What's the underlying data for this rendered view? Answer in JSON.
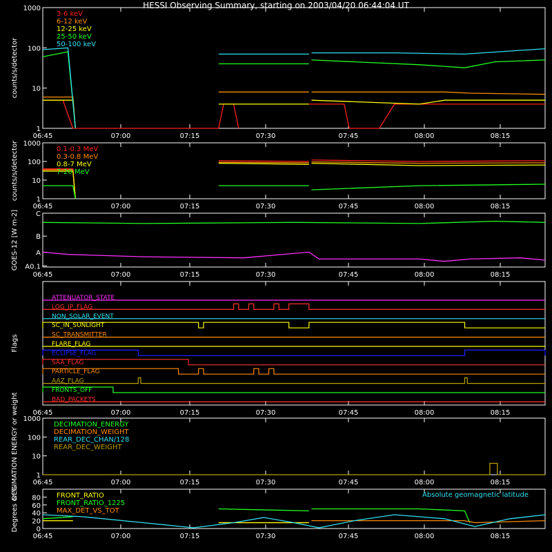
{
  "title": "HESSI Observing Summary, starting on 2003/04/20 06:44:04 UT",
  "time_ticks": [
    "06:45",
    "07:00",
    "07:15",
    "07:30",
    "07:45",
    "08:00",
    "08:15"
  ],
  "chart_data": [
    {
      "type": "line",
      "panel": "hessi-low-energy",
      "ylabel": "counts/s/detector",
      "yscale": "log",
      "ylim": [
        1,
        1000
      ],
      "y_ticks": [
        "1",
        "10",
        "100",
        "1000"
      ],
      "legend": [
        {
          "name": "3-6 keV",
          "color": "#ff2020"
        },
        {
          "name": "6-12 keV",
          "color": "#ff8c00"
        },
        {
          "name": "12-25 keV",
          "color": "#ffff00"
        },
        {
          "name": "25-50 keV",
          "color": "#20ff20"
        },
        {
          "name": "50-100 keV",
          "color": "#30e0f0"
        }
      ],
      "series": [
        {
          "name": "3-6 keV",
          "color": "#ff2020",
          "segments": [
            [
              [
                0,
                5
              ],
              [
                4,
                5
              ],
              [
                6,
                1
              ],
              [
                35,
                1
              ],
              [
                36,
                4
              ],
              [
                38,
                4
              ],
              [
                39,
                1
              ]
            ],
            [
              [
                53,
                4
              ],
              [
                60,
                4
              ],
              [
                61,
                1
              ],
              [
                67,
                1
              ],
              [
                70,
                4
              ],
              [
                100,
                4
              ]
            ]
          ]
        },
        {
          "name": "6-12 keV",
          "color": "#ff8c00",
          "segments": [
            [
              [
                0,
                6
              ],
              [
                6,
                6
              ],
              [
                6.5,
                1
              ]
            ],
            [
              [
                35,
                8
              ],
              [
                53,
                8
              ]
            ],
            [
              [
                53.5,
                8
              ],
              [
                80,
                8
              ],
              [
                85,
                7.5
              ],
              [
                100,
                7
              ]
            ]
          ]
        },
        {
          "name": "12-25 keV",
          "color": "#ffff00",
          "segments": [
            [
              [
                0,
                5
              ],
              [
                6,
                5
              ],
              [
                6.5,
                1
              ]
            ],
            [
              [
                35,
                4
              ],
              [
                53,
                4
              ]
            ],
            [
              [
                53.5,
                5
              ],
              [
                75,
                4
              ],
              [
                80,
                5
              ],
              [
                100,
                5
              ]
            ]
          ]
        },
        {
          "name": "25-50 keV",
          "color": "#20ff20",
          "segments": [
            [
              [
                0,
                60
              ],
              [
                5,
                80
              ],
              [
                6.5,
                1
              ]
            ],
            [
              [
                35,
                40
              ],
              [
                53,
                40
              ]
            ],
            [
              [
                53.5,
                50
              ],
              [
                75,
                38
              ],
              [
                84,
                32
              ],
              [
                90,
                45
              ],
              [
                100,
                50
              ]
            ]
          ]
        },
        {
          "name": "50-100 keV",
          "color": "#30e0f0",
          "segments": [
            [
              [
                0,
                90
              ],
              [
                5,
                100
              ],
              [
                6.5,
                1
              ]
            ],
            [
              [
                35,
                70
              ],
              [
                53,
                70
              ]
            ],
            [
              [
                53.5,
                75
              ],
              [
                70,
                75
              ],
              [
                84,
                70
              ],
              [
                100,
                95
              ]
            ]
          ]
        }
      ]
    },
    {
      "type": "line",
      "panel": "hessi-high-energy",
      "ylabel": "counts/s/detector",
      "yscale": "log",
      "ylim": [
        1,
        1000
      ],
      "y_ticks": [
        "1",
        "10",
        "100",
        "1000"
      ],
      "legend": [
        {
          "name": "0.1-0.3 MeV",
          "color": "#ff2020"
        },
        {
          "name": "0.3-0.8 MeV",
          "color": "#ff8c00"
        },
        {
          "name": "0.8-7 MeV",
          "color": "#ffff00"
        },
        {
          "name": "7-20 MeV",
          "color": "#20ff20"
        }
      ],
      "series": [
        {
          "name": "0.1-0.3 MeV",
          "color": "#ff2020",
          "segments": [
            [
              [
                0,
                40
              ],
              [
                6,
                40
              ],
              [
                6.5,
                1
              ]
            ],
            [
              [
                35,
                110
              ],
              [
                53,
                100
              ]
            ],
            [
              [
                53.5,
                120
              ],
              [
                75,
                100
              ],
              [
                100,
                110
              ]
            ]
          ]
        },
        {
          "name": "0.3-0.8 MeV",
          "color": "#ff8c00",
          "segments": [
            [
              [
                0,
                35
              ],
              [
                6,
                35
              ],
              [
                6.5,
                1
              ]
            ],
            [
              [
                35,
                90
              ],
              [
                53,
                85
              ]
            ],
            [
              [
                53.5,
                95
              ],
              [
                75,
                80
              ],
              [
                100,
                85
              ]
            ]
          ]
        },
        {
          "name": "0.8-7 MeV",
          "color": "#ffff00",
          "segments": [
            [
              [
                0,
                30
              ],
              [
                6,
                30
              ],
              [
                6.5,
                1
              ]
            ],
            [
              [
                35,
                80
              ],
              [
                53,
                70
              ]
            ],
            [
              [
                53.5,
                80
              ],
              [
                75,
                60
              ],
              [
                100,
                65
              ]
            ]
          ]
        },
        {
          "name": "7-20 MeV",
          "color": "#20ff20",
          "segments": [
            [
              [
                0,
                5
              ],
              [
                6,
                5
              ],
              [
                6.5,
                1
              ]
            ],
            [
              [
                35,
                5
              ],
              [
                53,
                5
              ]
            ],
            [
              [
                53.5,
                3
              ],
              [
                75,
                5
              ],
              [
                100,
                6
              ]
            ]
          ]
        }
      ]
    },
    {
      "type": "line",
      "panel": "goes",
      "ylabel": "GOES-12 [W m-2]",
      "y_ticks": [
        "A0.1",
        "A",
        "B",
        "C"
      ],
      "series": [
        {
          "name": "goes-long",
          "color": "#20ff20",
          "segments": [
            [
              [
                0,
                1.6
              ],
              [
                20,
                1.55
              ],
              [
                50,
                1.6
              ],
              [
                75,
                1.55
              ],
              [
                90,
                1.65
              ],
              [
                100,
                1.6
              ]
            ]
          ]
        },
        {
          "name": "goes-short",
          "color": "#ff30ff",
          "segments": [
            [
              [
                0,
                0.3
              ],
              [
                5,
                0.2
              ],
              [
                20,
                0.1
              ],
              [
                40,
                0.05
              ],
              [
                53,
                0.3
              ],
              [
                55,
                0
              ],
              [
                75,
                0
              ],
              [
                80,
                -0.1
              ],
              [
                85,
                0
              ],
              [
                95,
                0.05
              ],
              [
                100,
                -0.05
              ]
            ]
          ]
        }
      ]
    },
    {
      "type": "line",
      "panel": "flags",
      "ylabel": "Flags",
      "flags": [
        {
          "name": "ATTENUATOR_STATE",
          "color": "#ff30ff",
          "on": []
        },
        {
          "name": "LOG_IP_FLAG",
          "color": "#ff3030",
          "on": [
            [
              38,
              39
            ],
            [
              41,
              42
            ],
            [
              46,
              47
            ],
            [
              49,
              53
            ]
          ]
        },
        {
          "name": "NON_SOLAR_EVENT",
          "color": "#30e0f0",
          "on": []
        },
        {
          "name": "SC_IN_SUNLIGHT",
          "color": "#ffff00",
          "on": [
            [
              0,
              31
            ],
            [
              32,
              49
            ],
            [
              53,
              84
            ]
          ]
        },
        {
          "name": "SC_TRANSMITTER",
          "color": "#ff8c00",
          "on": []
        },
        {
          "name": "FLARE_FLAG",
          "color": "#ffff00",
          "on": []
        },
        {
          "name": "ECLIPSE_FLAG",
          "color": "#2020ff",
          "on": [
            [
              0,
              19
            ],
            [
              84,
              100
            ]
          ]
        },
        {
          "name": "SAA_FLAG",
          "color": "#ff3030",
          "on": [
            [
              0,
              29
            ]
          ]
        },
        {
          "name": "PARTICLE_FLAG",
          "color": "#ff8c00",
          "on": [
            [
              0,
              27
            ],
            [
              31,
              32
            ],
            [
              42,
              43
            ],
            [
              45,
              46
            ]
          ]
        },
        {
          "name": "AAZ_FLAG",
          "color": "#b8a000",
          "on": [
            [
              19,
              19.5
            ],
            [
              84,
              84.5
            ]
          ]
        },
        {
          "name": "FRONTS_OFF",
          "color": "#20ff20",
          "on": [
            [
              0,
              14
            ]
          ]
        },
        {
          "name": "BAD_PACKETS",
          "color": "#ff3030",
          "on": []
        }
      ]
    },
    {
      "type": "line",
      "panel": "decimation",
      "ylabel": "DECIMATION ENERGY or weight",
      "yscale": "log",
      "ylim": [
        1,
        1000
      ],
      "y_ticks": [
        "1",
        "10",
        "100",
        "1000"
      ],
      "legend": [
        {
          "name": "DECIMATION_ENERGY",
          "color": "#20ff20"
        },
        {
          "name": "DECIMATION_WEIGHT",
          "color": "#ff8c00"
        },
        {
          "name": "REAR_DEC_CHAN/128",
          "color": "#30e0f0"
        },
        {
          "name": "REAR_DEC_WEIGHT",
          "color": "#b8a000"
        }
      ],
      "series": [
        {
          "name": "REAR_DEC_WEIGHT",
          "color": "#b8a000",
          "segments": [
            [
              [
                0,
                1
              ],
              [
                89,
                1
              ],
              [
                89,
                4
              ],
              [
                90.5,
                4
              ],
              [
                90.5,
                1
              ],
              [
                100,
                1
              ]
            ]
          ]
        }
      ]
    },
    {
      "type": "line",
      "panel": "ratios",
      "ylabel": "Degrees or %",
      "ylim": [
        0,
        100
      ],
      "y_ticks": [
        "0",
        "20",
        "40",
        "60",
        "80"
      ],
      "legend": [
        {
          "name": "FRONT_RATIO",
          "color": "#ffff00"
        },
        {
          "name": "FRONT_RATIO_1225",
          "color": "#20ff20"
        },
        {
          "name": "MAX_DET_VS_TOT",
          "color": "#ff8c00"
        }
      ],
      "annotation": "Absolute geomagnetic latitude",
      "series": [
        {
          "name": "FRONT_RATIO_1225",
          "color": "#20ff20",
          "segments": [
            [
              [
                0,
                25
              ],
              [
                6,
                30
              ]
            ],
            [
              [
                35,
                50
              ],
              [
                53,
                45
              ]
            ],
            [
              [
                53.5,
                50
              ],
              [
                75,
                50
              ],
              [
                84,
                45
              ],
              [
                85,
                15
              ]
            ]
          ]
        },
        {
          "name": "MAX_DET_VS_TOT",
          "color": "#ff8c00",
          "segments": [
            [
              [
                0,
                20
              ],
              [
                6,
                20
              ]
            ],
            [
              [
                35,
                15
              ],
              [
                53,
                15
              ]
            ],
            [
              [
                53.5,
                20
              ],
              [
                84,
                20
              ],
              [
                86,
                15
              ],
              [
                100,
                20
              ]
            ]
          ]
        },
        {
          "name": "FRONT_RATIO",
          "color": "#ffff00",
          "segments": [
            [
              [
                0,
                20
              ],
              [
                6,
                20
              ]
            ],
            [
              [
                35,
                15
              ],
              [
                53,
                15
              ]
            ]
          ]
        },
        {
          "name": "Absolute geomagnetic latitude",
          "color": "#30e0f0",
          "segments": [
            [
              [
                0,
                35
              ],
              [
                8,
                30
              ],
              [
                20,
                15
              ],
              [
                30,
                2
              ],
              [
                38,
                15
              ],
              [
                44,
                28
              ],
              [
                50,
                15
              ],
              [
                55,
                2
              ],
              [
                62,
                20
              ],
              [
                70,
                35
              ],
              [
                80,
                25
              ],
              [
                86,
                5
              ],
              [
                93,
                25
              ],
              [
                100,
                35
              ]
            ]
          ]
        }
      ]
    }
  ]
}
